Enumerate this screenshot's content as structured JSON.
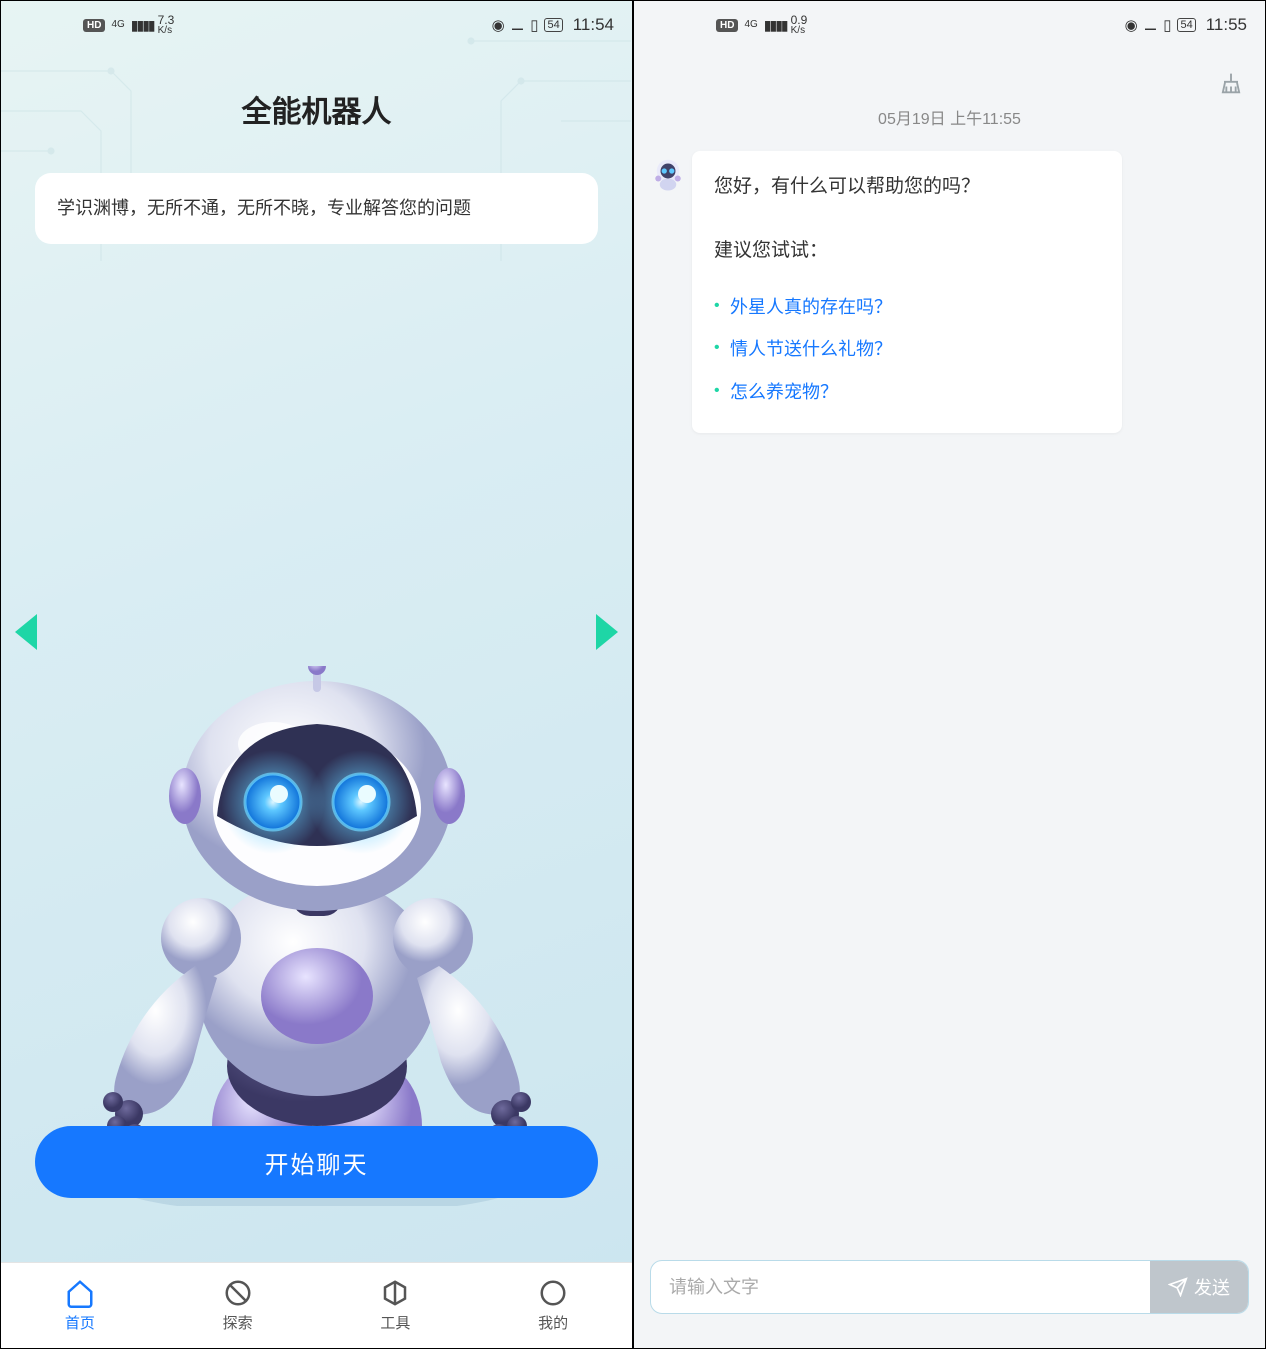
{
  "left": {
    "status": {
      "hd": "HD",
      "net": "4G",
      "speed_num": "7.3",
      "speed_unit": "K/s",
      "battery": "54",
      "time": "11:54"
    },
    "title": "全能机器人",
    "bubble": "学识渊博，无所不通，无所不晓，专业解答您的问题",
    "start_button": "开始聊天",
    "tabs": [
      {
        "label": "首页",
        "icon": "home-icon",
        "active": true
      },
      {
        "label": "探索",
        "icon": "explore-icon",
        "active": false
      },
      {
        "label": "工具",
        "icon": "tools-icon",
        "active": false
      },
      {
        "label": "我的",
        "icon": "profile-icon",
        "active": false
      }
    ]
  },
  "right": {
    "status": {
      "hd": "HD",
      "net": "4G",
      "speed_num": "0.9",
      "speed_unit": "K/s",
      "battery": "54",
      "time": "11:55"
    },
    "timestamp": "05月19日 上午11:55",
    "greeting": "您好，有什么可以帮助您的吗？",
    "suggest_title": "建议您试试：",
    "suggestions": [
      "外星人真的存在吗？",
      "情人节送什么礼物？",
      "怎么养宠物？"
    ],
    "input": {
      "placeholder": "请输入文字",
      "send": "发送"
    }
  },
  "colors": {
    "accent_blue": "#1678ff",
    "accent_teal": "#1ed6a6"
  }
}
